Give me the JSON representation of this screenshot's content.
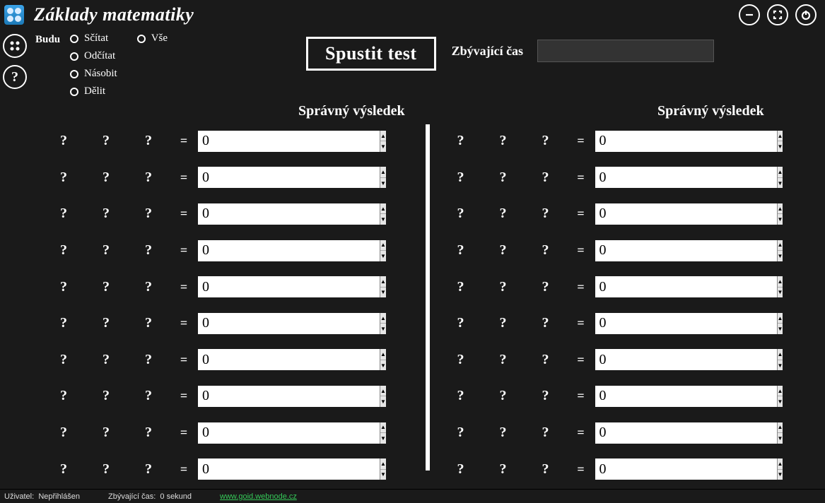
{
  "title": "Základy matematiky",
  "budu_label": "Budu",
  "radios_col1": [
    "Sčítat",
    "Odčítat",
    "Násobit",
    "Dělit"
  ],
  "radios_col2": [
    "Vše"
  ],
  "start_button": "Spustit test",
  "remaining_label": "Zbývající čas",
  "result_header": "Správný výsledek",
  "placeholder": "?",
  "equals": "=",
  "spinner_default": "0",
  "row_count": 10,
  "status": {
    "user_label": "Uživatel:",
    "user_value": "Nepřihlášen",
    "time_label": "Zbývající čas:",
    "time_value": "0 sekund",
    "link": "www.goid.webnode.cz"
  }
}
